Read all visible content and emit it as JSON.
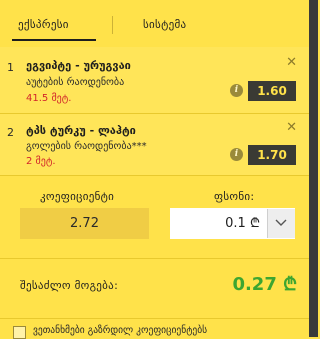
{
  "tabs": {
    "express": "ექსპრესი",
    "system": "სისტემა"
  },
  "bets": [
    {
      "num": "1",
      "title": "ეგვიპტე - ურუგვაი",
      "market": "აუტების რაოდენობა",
      "stake": "41.5 მეტ.",
      "odd": "1.60"
    },
    {
      "num": "2",
      "title": "ტპს ტურკუ - ლაჰტი",
      "market": "გოლების რაოდენობა***",
      "stake": "2 მეტ.",
      "odd": "1.70"
    }
  ],
  "coef": {
    "label": "კოეფიციენტი",
    "value": "2.72"
  },
  "stake": {
    "label": "ფსონი:",
    "value": "0.1 ₾"
  },
  "win": {
    "label": "შესაძლო მოგება:",
    "value": "0.27 ₾"
  },
  "footer": {
    "checkbox_label": "ვეთანხმები გაზრდილ კოეფიციენტებს"
  },
  "colors": {
    "background": "#ffe24a",
    "odd_bg": "#3a3a34",
    "win_green": "#3da631",
    "stake_red": "#d2262a"
  }
}
